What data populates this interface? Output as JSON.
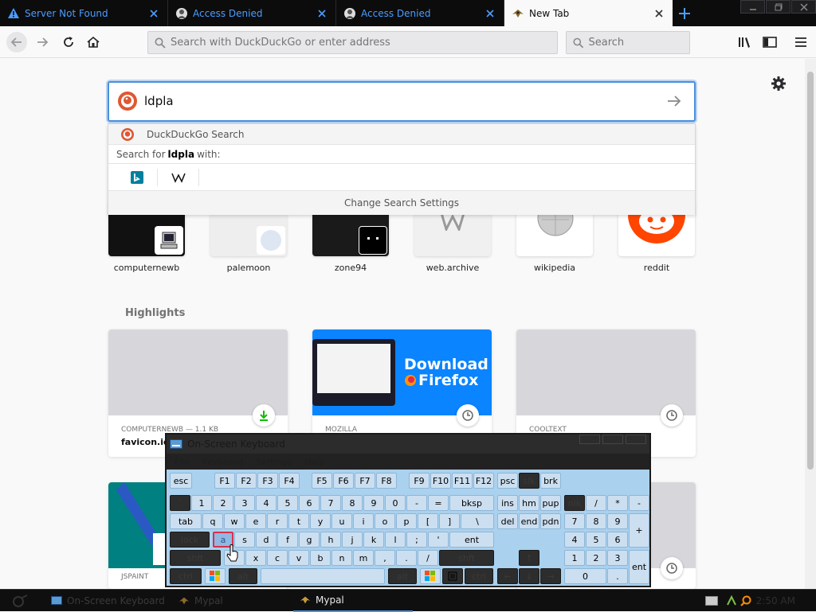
{
  "tabs": [
    {
      "label": "Server Not Found",
      "icon": "warning-icon"
    },
    {
      "label": "Access Denied",
      "icon": "access-denied-icon"
    },
    {
      "label": "Access Denied",
      "icon": "access-denied-icon"
    },
    {
      "label": "New Tab",
      "icon": "mypal-icon"
    }
  ],
  "nav": {
    "url_placeholder": "Search with DuckDuckGo or enter address",
    "search_placeholder": "Search"
  },
  "newtab": {
    "search_value": "ldpla",
    "dropdown": {
      "engine_label": "DuckDuckGo Search",
      "search_for_prefix": "Search for",
      "search_for_term": "ldpla",
      "search_for_suffix": "with:",
      "engines": [
        "Bing",
        "Wikipedia"
      ],
      "change_settings": "Change Search Settings"
    },
    "top_sites": [
      {
        "label": "computernewb"
      },
      {
        "label": "palemoon"
      },
      {
        "label": "zone94"
      },
      {
        "label": "web.archive"
      },
      {
        "label": "wikipedia"
      },
      {
        "label": "reddit"
      }
    ],
    "highlights_title": "Highlights",
    "highlights": [
      {
        "source": "COMPUTERNEWB — 1.1 KB",
        "title": "favicon.ico"
      },
      {
        "source": "MOZILLA",
        "title": "",
        "banner_line1": "Download",
        "banner_line2": "Firefox"
      },
      {
        "source": "COOLTEXT",
        "title": ""
      },
      {
        "source": "JSPAINT",
        "title": ""
      }
    ]
  },
  "osk": {
    "title": "On-Screen Keyboard",
    "menu": [
      "File",
      "Keyboard",
      "Settings",
      "Help"
    ],
    "row1": [
      "esc",
      "F1",
      "F2",
      "F3",
      "F4",
      "F5",
      "F6",
      "F7",
      "F8",
      "F9",
      "F10",
      "F11",
      "F12",
      "psc",
      "slk",
      "brk"
    ],
    "row2": [
      "`",
      "1",
      "2",
      "3",
      "4",
      "5",
      "6",
      "7",
      "8",
      "9",
      "0",
      "-",
      "=",
      "bksp",
      "ins",
      "hm",
      "pup",
      "nlk",
      "/",
      "*",
      "-"
    ],
    "row3": [
      "tab",
      "q",
      "w",
      "e",
      "r",
      "t",
      "y",
      "u",
      "i",
      "o",
      "p",
      "[",
      "]",
      "\\",
      "del",
      "end",
      "pdn",
      "7",
      "8",
      "9",
      "+"
    ],
    "row4": [
      "lock",
      "a",
      "s",
      "d",
      "f",
      "g",
      "h",
      "j",
      "k",
      "l",
      ";",
      "'",
      "ent",
      "4",
      "5",
      "6"
    ],
    "row5": [
      "shft",
      "z",
      "x",
      "c",
      "v",
      "b",
      "n",
      "m",
      ",",
      ".",
      "/",
      "shft",
      "↑",
      "1",
      "2",
      "3"
    ],
    "row6": [
      "ctrl",
      "",
      "alt",
      "",
      "alt",
      "",
      "",
      "ctrl",
      "←",
      "↓",
      "→",
      "0",
      ".",
      "ent"
    ]
  },
  "taskbar": {
    "items": [
      "On-Screen Keyboard",
      "Mypal",
      "Mypal"
    ],
    "clock": "2:50 AM"
  }
}
